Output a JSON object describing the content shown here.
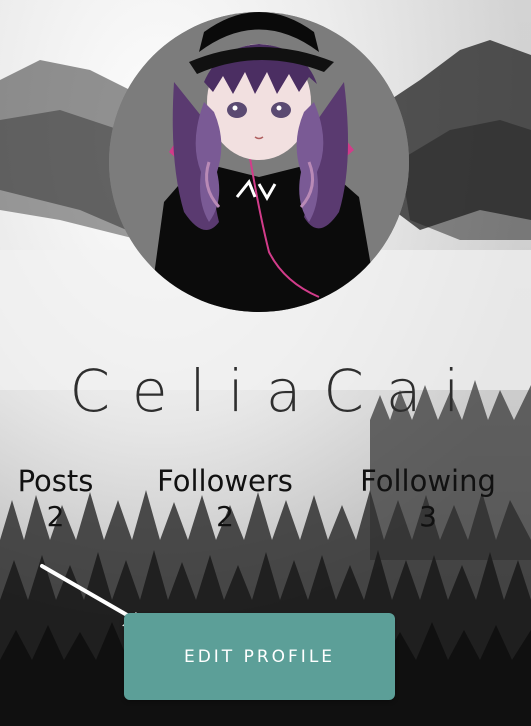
{
  "profile": {
    "username": "CeliaCai",
    "avatar_icon": "anime-girl-avatar"
  },
  "stats": [
    {
      "label": "Posts",
      "value": "2"
    },
    {
      "label": "Followers",
      "value": "2"
    },
    {
      "label": "Following",
      "value": "3"
    }
  ],
  "actions": {
    "edit_profile_label": "EDIT PROFILE"
  },
  "colors": {
    "button": "#5c9f98",
    "text": "#111111"
  }
}
